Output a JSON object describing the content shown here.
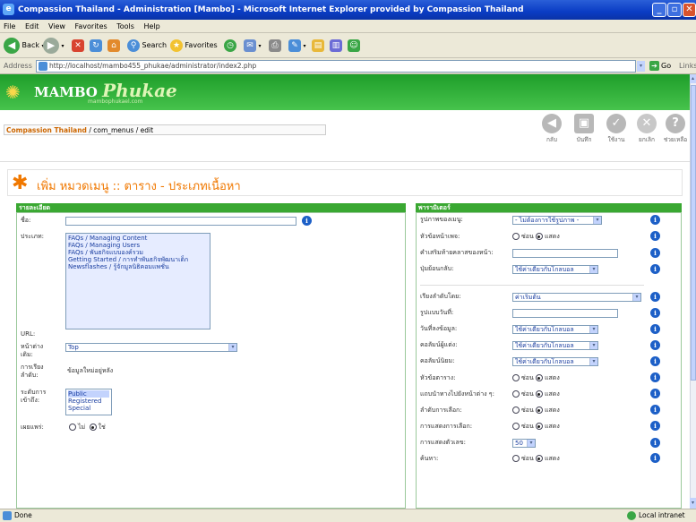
{
  "window": {
    "title": "Compassion Thailand - Administration [Mambo] - Microsoft Internet Explorer provided by Compassion Thailand",
    "minimize": "_",
    "maximize": "▫",
    "close": "✕"
  },
  "menu": [
    "File",
    "Edit",
    "View",
    "Favorites",
    "Tools",
    "Help"
  ],
  "toolbar": {
    "back": "Back",
    "search": "Search",
    "favorites": "Favorites"
  },
  "address": {
    "label": "Address",
    "url": "http://localhost/mambo455_phukae/administrator/index2.php",
    "go": "Go",
    "links": "Links"
  },
  "header": {
    "logo_main": "MAMBO",
    "logo_script": "Phukae",
    "logo_sub": "mambophukael.com"
  },
  "breadcrumb": {
    "site": "Compassion Thailand",
    "path": " / com_menus / edit"
  },
  "tools": [
    {
      "label": "กลับ",
      "icon": "back-arrow-icon"
    },
    {
      "label": "บันทึก",
      "icon": "save-icon"
    },
    {
      "label": "ใช้งาน",
      "icon": "apply-icon"
    },
    {
      "label": "ยกเลิก",
      "icon": "cancel-icon"
    },
    {
      "label": "ช่วยเหลือ",
      "icon": "help-icon"
    }
  ],
  "page_title": "เพิ่ม หมวดเมนู :: ตาราง - ประเภทเนื้อหา",
  "details": {
    "heading": "รายละเอียด",
    "name_label": "ชื่อ:",
    "name_value": "",
    "type_label": "ประเภท:",
    "type_options": [
      "FAQs / Managing Content",
      "FAQs / Managing Users",
      "FAQs / พันธกิจแบบองค์รวม",
      "Getting Started / การทำพันธกิจพัฒนาเด็ก",
      "Newsflashes / รู้จักมูลนิธิคอมแพชั่น"
    ],
    "url_label": "URL:",
    "window_label": "หน้าต่าง",
    "window_label2": "เดิม:",
    "window_value": "Top",
    "order_label": "การเรียง",
    "order_label2": "ลำดับ:",
    "order_value": "ข้อมูลใหม่อยู่หลัง",
    "access_label": "ระดับการ",
    "access_label2": "เข้าถึง:",
    "access_options": [
      "Public",
      "Registered",
      "Special"
    ],
    "published_label": "เผยแพร่:",
    "published_no": "ไม่",
    "published_yes": "ใช่"
  },
  "params": {
    "heading": "พารามิเตอร์",
    "rows": [
      {
        "label": "รูปภาพของเมนู:",
        "type": "select",
        "value": "- ไม่ต้องการใช้รูปภาพ -"
      },
      {
        "label": "หัวข้อหน้าเพจ:",
        "type": "radio",
        "hide": "ซ่อน",
        "show": "แสดง"
      },
      {
        "label": "คำเสริมท้ายคลาสของหน้า:",
        "type": "text",
        "value": ""
      },
      {
        "label": "ปุ่มย้อนกลับ:",
        "type": "select",
        "value": "ใช้ค่าเดียวกับโกลบอล"
      },
      {
        "label": "เรียงลำดับโดย:",
        "type": "select-wide",
        "value": "ค่าเริ่มต้น"
      },
      {
        "label": "รูปแบบวันที่:",
        "type": "text",
        "value": ""
      },
      {
        "label": "วันที่ลงข้อมูล:",
        "type": "select",
        "value": "ใช้ค่าเดียวกับโกลบอล"
      },
      {
        "label": "คอลัมน์ผู้แต่ง:",
        "type": "select",
        "value": "ใช้ค่าเดียวกับโกลบอล"
      },
      {
        "label": "คอลัมน์นิยม:",
        "type": "select",
        "value": "ใช้ค่าเดียวกับโกลบอล"
      },
      {
        "label": "หัวข้อตาราง:",
        "type": "radio",
        "hide": "ซ่อน",
        "show": "แสดง"
      },
      {
        "label": "แถบนำทางไปยังหน้าต่าง ๆ:",
        "type": "radio",
        "hide": "ซ่อน",
        "show": "แสดง"
      },
      {
        "label": "ลำดับการเลือก:",
        "type": "radio",
        "hide": "ซ่อน",
        "show": "แสดง"
      },
      {
        "label": "การแสดงการเลือก:",
        "type": "radio",
        "hide": "ซ่อน",
        "show": "แสดง"
      },
      {
        "label": "การแสดงตัวเลข:",
        "type": "select-small",
        "value": "50"
      },
      {
        "label": "ค้นหา:",
        "type": "radio",
        "hide": "ซ่อน",
        "show": "แสดง"
      }
    ]
  },
  "status": {
    "left": "Done",
    "right": "Local intranet"
  }
}
